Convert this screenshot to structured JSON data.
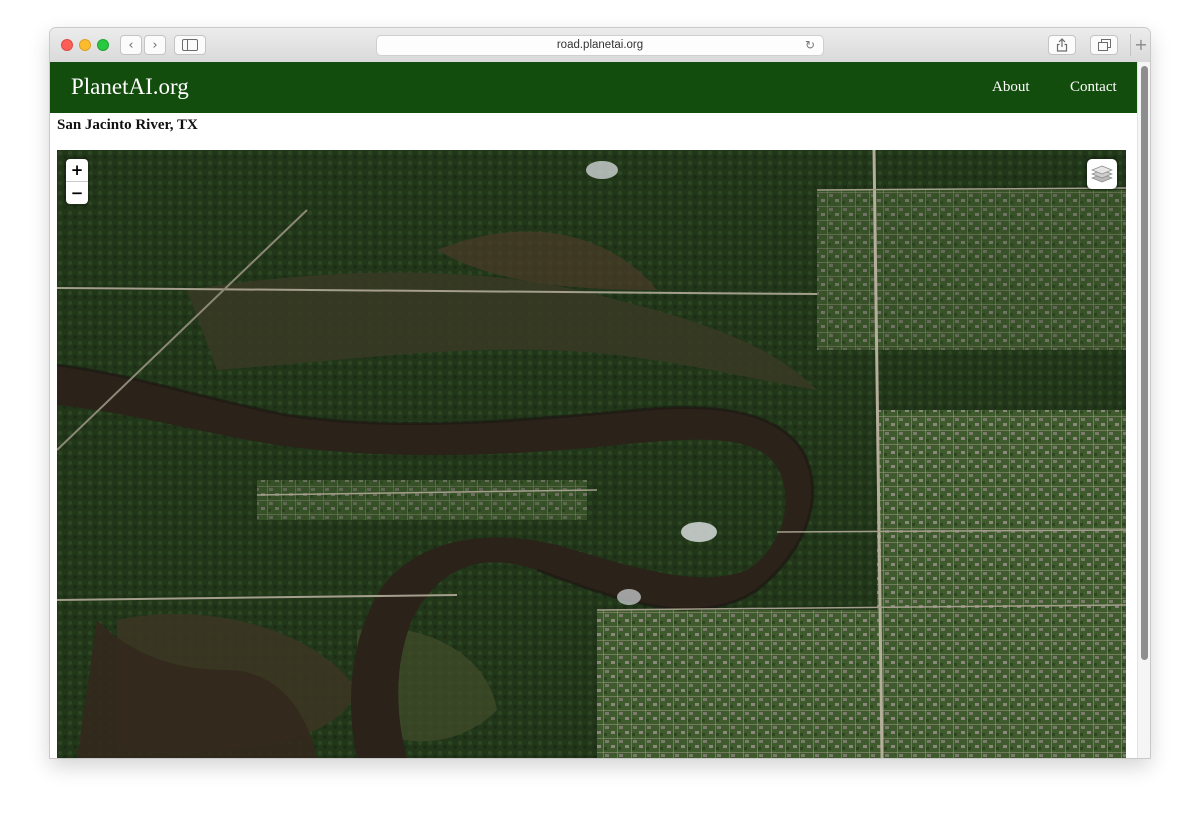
{
  "browser": {
    "address": "road.planetai.org",
    "back_glyph": "‹",
    "forward_glyph": "›",
    "reload_glyph": "↻",
    "new_tab_glyph": "+"
  },
  "site": {
    "brand": "PlanetAI.org",
    "nav": [
      {
        "label": "About"
      },
      {
        "label": "Contact"
      }
    ]
  },
  "page": {
    "title": "San Jacinto River, TX"
  },
  "map": {
    "zoom_in_label": "+",
    "zoom_out_label": "−",
    "layers_icon": "layers-icon"
  },
  "colors": {
    "navbar": "#134d0d",
    "river": "#2b2219"
  }
}
